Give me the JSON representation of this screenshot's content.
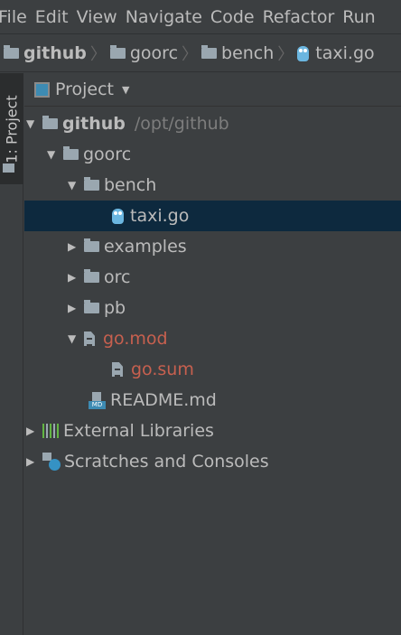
{
  "menu": [
    "File",
    "Edit",
    "View",
    "Navigate",
    "Code",
    "Refactor",
    "Run"
  ],
  "breadcrumb": [
    {
      "label": "github",
      "icon": "folder-icon"
    },
    {
      "label": "goorc",
      "icon": "folder-icon"
    },
    {
      "label": "bench",
      "icon": "folder-icon"
    },
    {
      "label": "taxi.go",
      "icon": "go-file-icon"
    }
  ],
  "tool_window_tab": "1: Project",
  "panel": {
    "title": "Project"
  },
  "tree": {
    "root": {
      "label": "github",
      "path": "/opt/github"
    },
    "goorc": "goorc",
    "bench": "bench",
    "taxi": "taxi.go",
    "examples": "examples",
    "orc": "orc",
    "pb": "pb",
    "gomod": "go.mod",
    "gosum": "go.sum",
    "readme": "README.md",
    "external": "External Libraries",
    "scratches": "Scratches and Consoles"
  },
  "colors": {
    "background": "#3c3f41",
    "selection": "#0d293e",
    "modified": "#c7604f"
  }
}
